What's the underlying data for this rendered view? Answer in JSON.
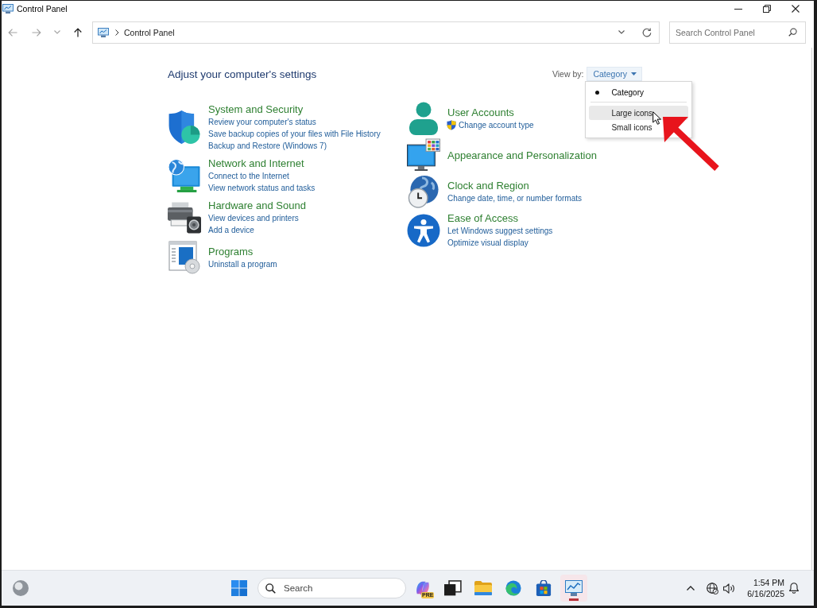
{
  "window": {
    "title": "Control Panel"
  },
  "toolbar": {
    "nav": [
      {
        "kind": "back",
        "disabled": true
      },
      {
        "kind": "forward",
        "disabled": true
      },
      {
        "kind": "recent",
        "disabled": true
      },
      {
        "kind": "up",
        "disabled": false
      }
    ],
    "address": {
      "crumbs": [
        "Control Panel"
      ]
    },
    "search": {
      "placeholder": "Search Control Panel"
    }
  },
  "page": {
    "heading": "Adjust your computer's settings",
    "view_by": {
      "label": "View by:",
      "value": "Category",
      "expanded": true,
      "options": [
        {
          "label": "Category",
          "selected": true,
          "hovered": false
        },
        {
          "label": "Large icons",
          "selected": false,
          "hovered": true
        },
        {
          "label": "Small icons",
          "selected": false,
          "hovered": false
        }
      ]
    }
  },
  "category_columns": [
    {
      "items": [
        {
          "kind": "security",
          "title": "System and Security",
          "links": [
            {
              "text": "Review your computer's status",
              "elevated": false
            },
            {
              "text": "Save backup copies of your files with File History",
              "elevated": false
            },
            {
              "text": "Backup and Restore (Windows 7)",
              "elevated": false
            }
          ]
        },
        {
          "kind": "network",
          "title": "Network and Internet",
          "links": [
            {
              "text": "Connect to the Internet",
              "elevated": false
            },
            {
              "text": "View network status and tasks",
              "elevated": false
            }
          ]
        },
        {
          "kind": "hardware",
          "title": "Hardware and Sound",
          "links": [
            {
              "text": "View devices and printers",
              "elevated": false
            },
            {
              "text": "Add a device",
              "elevated": false
            }
          ]
        },
        {
          "kind": "programs",
          "title": "Programs",
          "links": [
            {
              "text": "Uninstall a program",
              "elevated": false
            }
          ]
        }
      ]
    },
    {
      "items": [
        {
          "kind": "accounts",
          "title": "User Accounts",
          "links": [
            {
              "text": "Change account type",
              "elevated": true
            }
          ]
        },
        {
          "kind": "appearance",
          "title": "Appearance and Personalization"
        },
        {
          "kind": "clock",
          "title": "Clock and Region",
          "links": [
            {
              "text": "Change date, time, or number formats",
              "elevated": false
            }
          ]
        },
        {
          "kind": "access",
          "title": "Ease of Access",
          "links": [
            {
              "text": "Let Windows suggest settings",
              "elevated": false
            },
            {
              "text": "Optimize visual display",
              "elevated": false
            }
          ]
        }
      ]
    }
  ],
  "taskbar": {
    "search": {
      "placeholder": "Search"
    },
    "apps": [
      {
        "kind": "copilot",
        "badge": "PRE",
        "active": false
      },
      {
        "kind": "taskview",
        "active": false
      },
      {
        "kind": "explorer",
        "active": false
      },
      {
        "kind": "edge",
        "active": false
      },
      {
        "kind": "store",
        "active": false
      },
      {
        "kind": "controlpanel",
        "active": true
      }
    ],
    "clock": {
      "time": "1:54 PM",
      "date": "6/16/2025"
    }
  }
}
